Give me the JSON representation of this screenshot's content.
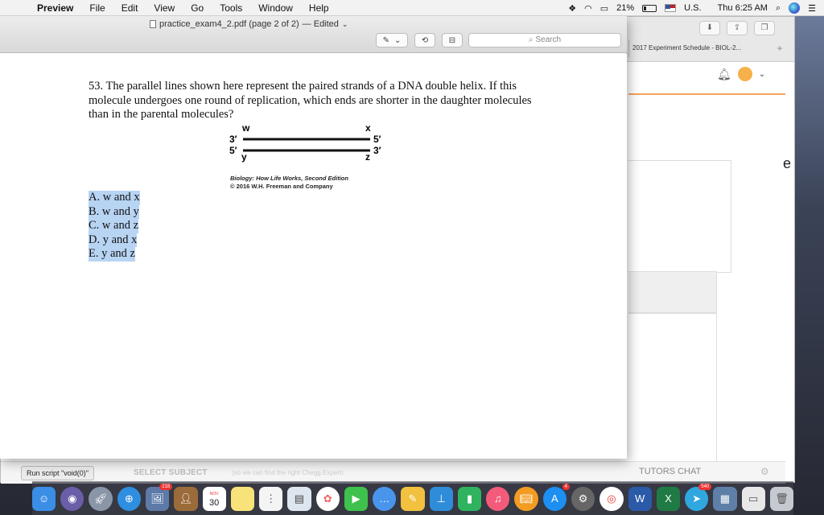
{
  "menubar": {
    "app": "Preview",
    "menus": [
      "File",
      "Edit",
      "View",
      "Go",
      "Tools",
      "Window",
      "Help"
    ],
    "battery": "21%",
    "input_source": "U.S.",
    "clock": "Thu 6:25 AM"
  },
  "preview": {
    "doc_title": "practice_exam4_2.pdf (page 2 of 2)",
    "edited": "— Edited",
    "search_placeholder": "Search"
  },
  "question": {
    "text": "53. The parallel lines shown here represent the paired strands of a DNA double helix. If this molecule undergoes one round of replication, which ends are shorter in the daughter molecules than in the parental molecules?",
    "diagram": {
      "label_w": "w",
      "label_x": "x",
      "label_y": "y",
      "label_z": "z",
      "left_top": "3′",
      "left_bottom": "5′",
      "right_top": "5′",
      "right_bottom": "3′"
    },
    "credit_title": "Biology: How Life Works, Second Edition",
    "credit_line": "© 2016 W.H. Freeman and Company",
    "answers": [
      "A. w and x",
      "B. w and y",
      "C. w and z",
      "D. y and x",
      "E. y and z"
    ]
  },
  "browser": {
    "tab_title": "2017 Experiment Schedule - BIOL-2...",
    "select_subject": "SELECT SUBJECT",
    "hint": "(so we can find the right Chegg Expert)",
    "tutors_chat": "TUTORS CHAT",
    "letter": "e"
  },
  "status": "Run script \"void(0)\"",
  "dock": {
    "calendar_month": "NOV",
    "calendar_day": "30",
    "badges": {
      "photos_app": "218",
      "app_store": "4",
      "telegram": "540"
    }
  }
}
